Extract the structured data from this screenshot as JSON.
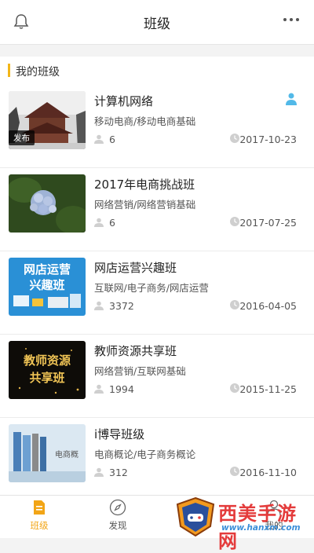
{
  "header": {
    "title": "班级"
  },
  "section": {
    "label": "我的班级"
  },
  "classes": [
    {
      "name": "计算机网络",
      "category": "移动电商/移动电商基础",
      "members": "6",
      "date": "2017-10-23",
      "badge": "发布"
    },
    {
      "name": "2017年电商挑战班",
      "category": "网络营销/网络营销基础",
      "members": "6",
      "date": "2017-07-25"
    },
    {
      "name": "网店运营兴趣班",
      "category": "互联网/电子商务/网店运营",
      "members": "3372",
      "date": "2016-04-05",
      "thumb_text": [
        "网店运营",
        "兴趣班"
      ]
    },
    {
      "name": "教师资源共享班",
      "category": "网络营销/互联网基础",
      "members": "1994",
      "date": "2015-11-25",
      "thumb_text": [
        "教师资源",
        "共享班"
      ]
    },
    {
      "name": "i博导班级",
      "category": "电商概论/电子商务概论",
      "members": "312",
      "date": "2016-11-10",
      "thumb_text": [
        "电商概"
      ]
    }
  ],
  "tabs": [
    {
      "label": "班级",
      "icon": "class-icon",
      "active": true
    },
    {
      "label": "发现",
      "icon": "compass-icon"
    },
    {
      "label": "我的",
      "icon": "person-icon"
    }
  ],
  "watermark": {
    "text": "西美手游网",
    "url": "www.hanxm.com"
  },
  "colors": {
    "accent": "#f2a516",
    "user_icon": "#52b9e8"
  }
}
